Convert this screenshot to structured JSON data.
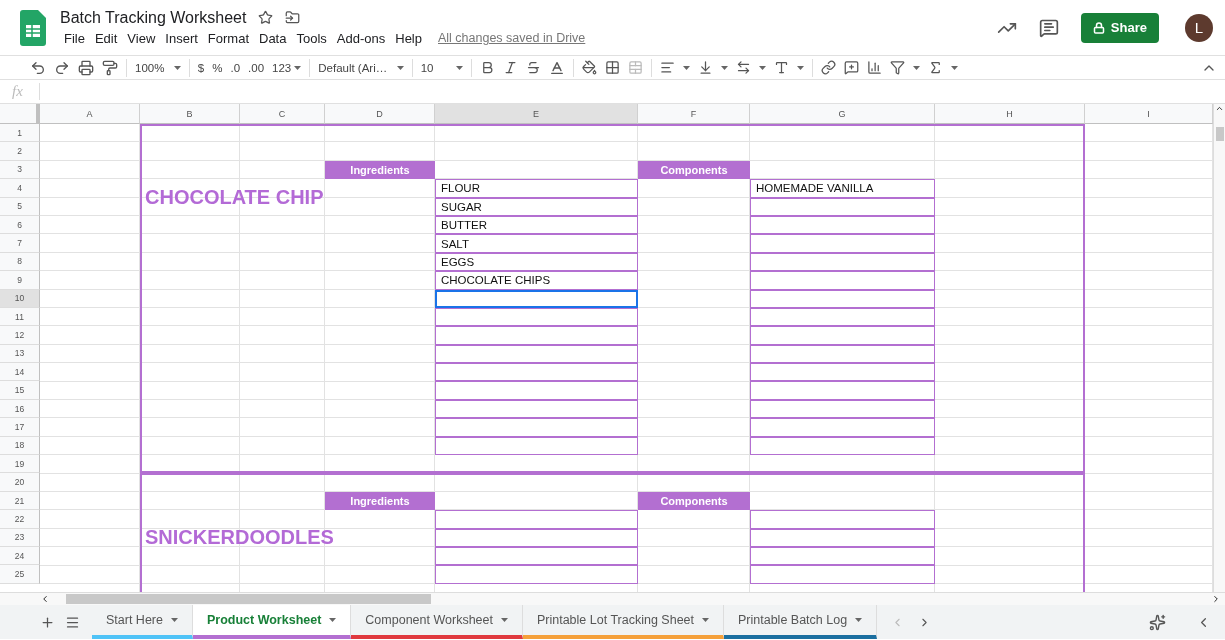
{
  "app": {
    "title": "Batch Tracking Worksheet",
    "menu": [
      "File",
      "Edit",
      "View",
      "Insert",
      "Format",
      "Data",
      "Tools",
      "Add-ons",
      "Help"
    ],
    "save_status": "All changes saved in Drive",
    "share": "Share",
    "avatar": "L"
  },
  "toolbar": {
    "zoom": "100%",
    "currency": "$",
    "percent": "%",
    "decimal_less": ".0",
    "decimal_more": ".00",
    "number_format": "123",
    "font": "Default (Ari…",
    "font_size": "10"
  },
  "formula_bar": {
    "label": "fx"
  },
  "columns": [
    {
      "label": "A",
      "selected": false
    },
    {
      "label": "B",
      "selected": false
    },
    {
      "label": "C",
      "selected": false
    },
    {
      "label": "D",
      "selected": false
    },
    {
      "label": "E",
      "selected": true
    },
    {
      "label": "F",
      "selected": false
    },
    {
      "label": "G",
      "selected": false
    },
    {
      "label": "H",
      "selected": false
    },
    {
      "label": "I",
      "selected": false
    }
  ],
  "rows": [
    {
      "label": "1",
      "selected": false
    },
    {
      "label": "2",
      "selected": false
    },
    {
      "label": "3",
      "selected": false
    },
    {
      "label": "4",
      "selected": false
    },
    {
      "label": "5",
      "selected": false
    },
    {
      "label": "6",
      "selected": false
    },
    {
      "label": "7",
      "selected": false
    },
    {
      "label": "8",
      "selected": false
    },
    {
      "label": "9",
      "selected": false
    },
    {
      "label": "10",
      "selected": true
    },
    {
      "label": "11",
      "selected": false
    },
    {
      "label": "12",
      "selected": false
    },
    {
      "label": "13",
      "selected": false
    },
    {
      "label": "14",
      "selected": false
    },
    {
      "label": "15",
      "selected": false
    },
    {
      "label": "16",
      "selected": false
    },
    {
      "label": "17",
      "selected": false
    },
    {
      "label": "18",
      "selected": false
    },
    {
      "label": "19",
      "selected": false
    },
    {
      "label": "20",
      "selected": false
    },
    {
      "label": "21",
      "selected": false
    },
    {
      "label": "22",
      "selected": false
    },
    {
      "label": "23",
      "selected": false
    },
    {
      "label": "24",
      "selected": false
    },
    {
      "label": "25",
      "selected": false
    }
  ],
  "sections": [
    {
      "title": "CHOCOLATE CHIP",
      "ingredients_header": "Ingredients",
      "components_header": "Components",
      "ingredients": [
        "FLOUR",
        "SUGAR",
        "BUTTER",
        "SALT",
        "EGGS",
        "CHOCOLATE CHIPS"
      ],
      "components": [
        "HOMEMADE VANILLA"
      ]
    },
    {
      "title": "SNICKERDOODLES",
      "ingredients_header": "Ingredients",
      "components_header": "Components"
    }
  ],
  "sheet_tabs": [
    {
      "label": "Start Here",
      "color": "#4fc3f7",
      "selected": false
    },
    {
      "label": "Product Worksheet",
      "color": "#b36fd1",
      "selected": true
    },
    {
      "label": "Component Worksheet",
      "color": "#e0393e",
      "selected": false
    },
    {
      "label": "Printable Lot Tracking Sheet",
      "color": "#f5a03a",
      "selected": false
    },
    {
      "label": "Printable Batch Log",
      "color": "#1b6fa0",
      "selected": false
    }
  ]
}
